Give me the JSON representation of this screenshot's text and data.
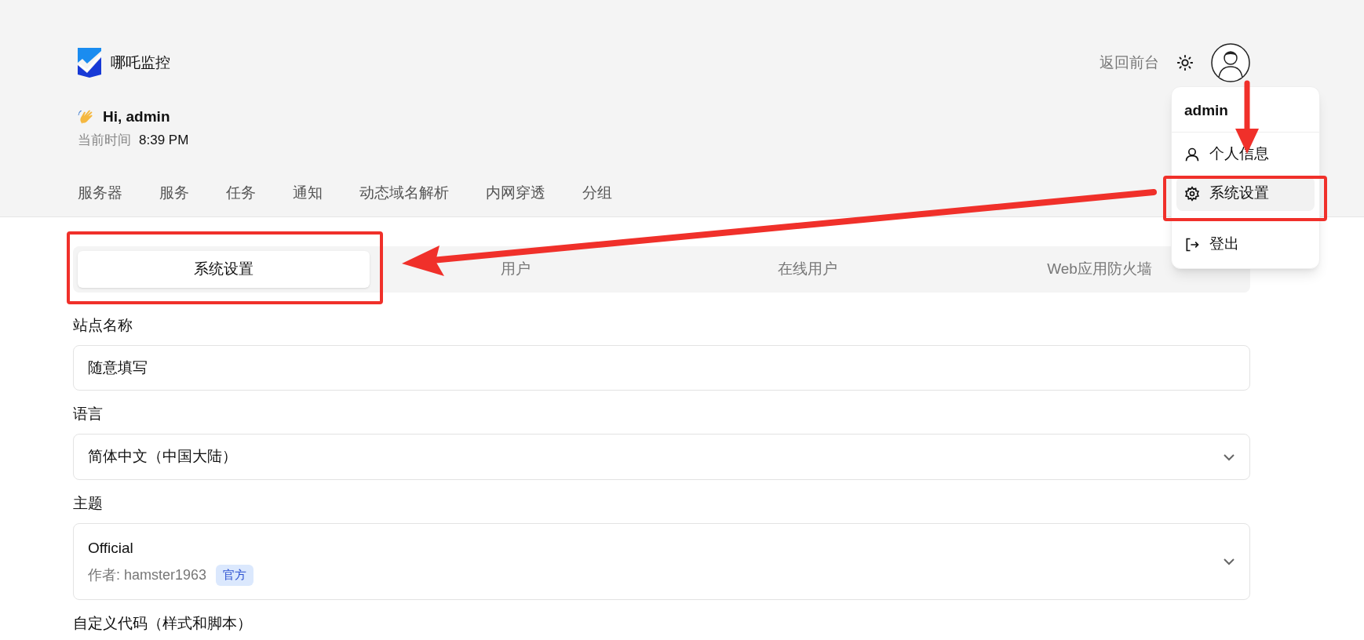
{
  "brand": {
    "title": "哪吒监控"
  },
  "header": {
    "back_link": "返回前台"
  },
  "greeting": {
    "text": "Hi, admin",
    "time_label": "当前时间",
    "time": "8:39 PM"
  },
  "nav": [
    {
      "label": "服务器",
      "selected": false
    },
    {
      "label": "服务",
      "selected": false
    },
    {
      "label": "任务",
      "selected": false
    },
    {
      "label": "通知",
      "selected": false
    },
    {
      "label": "动态域名解析",
      "selected": false
    },
    {
      "label": "内网穿透",
      "selected": false
    },
    {
      "label": "分组",
      "selected": false
    }
  ],
  "user_menu": {
    "username": "admin",
    "items": [
      {
        "kind": "profile",
        "label": "个人信息",
        "selected": false
      },
      {
        "kind": "settings",
        "label": "系统设置",
        "selected": true
      },
      {
        "kind": "logout",
        "label": "登出",
        "selected": false
      }
    ]
  },
  "settings_tabs": [
    {
      "label": "系统设置",
      "selected": true
    },
    {
      "label": "用户",
      "selected": false
    },
    {
      "label": "在线用户",
      "selected": false
    },
    {
      "label": "Web应用防火墙",
      "selected": false
    }
  ],
  "form": [
    {
      "kind": "text",
      "label": "站点名称",
      "value": "随意填写"
    },
    {
      "kind": "select",
      "label": "语言",
      "value": "简体中文（中国大陆）"
    },
    {
      "kind": "theme",
      "label": "主题",
      "value": "Official",
      "author": "作者: hamster1963",
      "badge": "官方"
    },
    {
      "kind": "heading",
      "label": "自定义代码（样式和脚本）"
    }
  ]
}
